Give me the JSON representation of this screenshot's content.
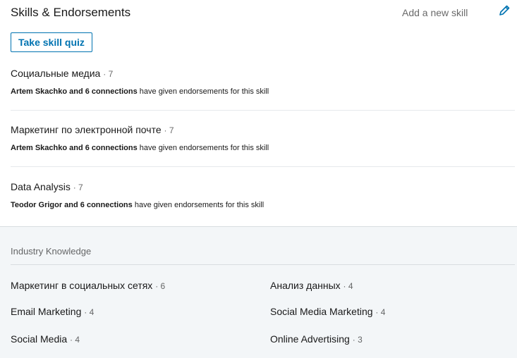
{
  "header": {
    "title": "Skills & Endorsements",
    "add_skill": "Add a new skill",
    "edit_icon": "pencil-icon"
  },
  "quiz_button": "Take skill quiz",
  "skills": [
    {
      "name": "Социальные медиа",
      "count": "· 7",
      "endorsers": "Artem Skachko and 6 connections",
      "endorse_text": "have given endorsements for this skill"
    },
    {
      "name": "Маркетинг по электронной почте",
      "count": "· 7",
      "endorsers": "Artem Skachko and 6 connections",
      "endorse_text": "have given endorsements for this skill"
    },
    {
      "name": "Data Analysis",
      "count": "· 7",
      "endorsers": "Teodor Grigor and 6 connections",
      "endorse_text": "have given endorsements for this skill"
    }
  ],
  "industry": {
    "title": "Industry Knowledge",
    "items": [
      {
        "name": "Маркетинг в социальных сетях",
        "count": "· 6"
      },
      {
        "name": "Анализ данных",
        "count": "· 4"
      },
      {
        "name": "Email Marketing",
        "count": "· 4"
      },
      {
        "name": "Social Media Marketing",
        "count": "· 4"
      },
      {
        "name": "Social Media",
        "count": "· 4"
      },
      {
        "name": "Online Advertising",
        "count": "· 3"
      }
    ]
  },
  "colors": {
    "accent": "#0073b1",
    "industry_bg": "#f3f6f8",
    "divider": "#e6e9ec"
  }
}
